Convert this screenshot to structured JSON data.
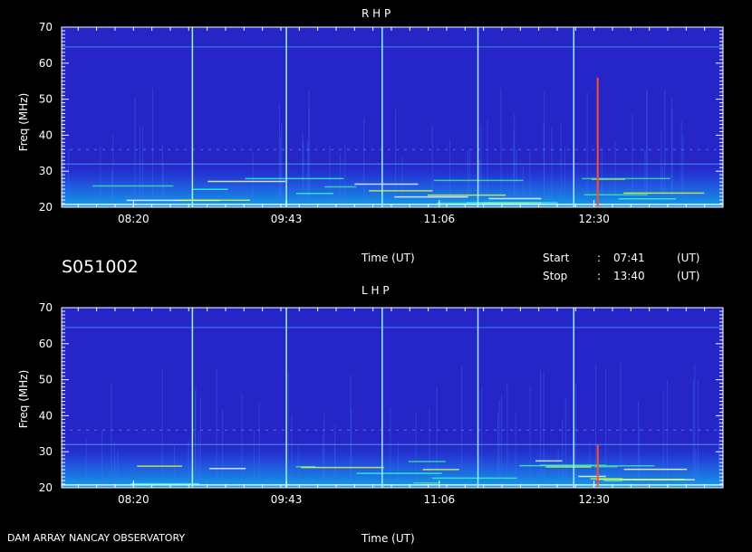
{
  "chart_data": [
    {
      "type": "heatmap",
      "title": "R H P",
      "xlabel": "Time (UT)",
      "ylabel": "Freq (MHz)",
      "xlim": [
        "07:41",
        "13:40"
      ],
      "ylim": [
        20,
        70
      ],
      "xticks": [
        "08:20",
        "09:43",
        "11:06",
        "12:30"
      ],
      "yticks": [
        20,
        30,
        40,
        50,
        60,
        70
      ],
      "vertical_markers": [
        "08:52",
        "09:43",
        "10:35",
        "11:27",
        "12:19"
      ],
      "burst": {
        "time": "12:32",
        "fmin": 20,
        "fmax": 56
      }
    },
    {
      "type": "heatmap",
      "title": "L H P",
      "xlabel": "Time (UT)",
      "ylabel": "Freq (MHz)",
      "xlim": [
        "07:41",
        "13:40"
      ],
      "ylim": [
        20,
        70
      ],
      "xticks": [
        "08:20",
        "09:43",
        "11:06",
        "12:30"
      ],
      "yticks": [
        20,
        30,
        40,
        50,
        60,
        70
      ],
      "vertical_markers": [
        "08:52",
        "09:43",
        "10:35",
        "11:27",
        "12:19"
      ],
      "burst": {
        "time": "12:32",
        "fmin": 20,
        "fmax": 32
      }
    }
  ],
  "info": {
    "id": "S051002",
    "start_label": "Start",
    "stop_label": "Stop",
    "colon": ":",
    "start": "07:41",
    "stop": "13:40",
    "unit": "(UT)",
    "footer": "DAM ARRAY   NANCAY OBSERVATORY"
  },
  "colors": {
    "background": "#2626c8",
    "marker": "#a0f0ff",
    "burst": "#ff5020",
    "axis": "#ffffff"
  }
}
